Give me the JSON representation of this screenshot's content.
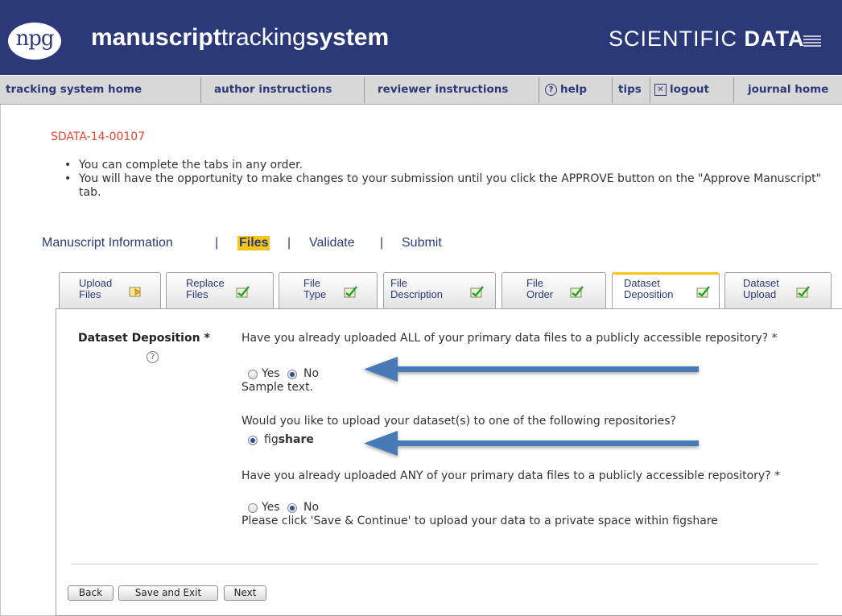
{
  "header": {
    "logo": "npg",
    "title_bold_1": "manuscript",
    "title_light": "tracking",
    "title_bold_2": "system",
    "brand_light": "SCIENTIFIC ",
    "brand_bold": "DATA"
  },
  "nav": {
    "items": [
      {
        "label": "tracking system home"
      },
      {
        "label": "author instructions"
      },
      {
        "label": "reviewer instructions"
      },
      {
        "label": "help",
        "icon": "help-icon"
      },
      {
        "label": "tips"
      },
      {
        "label": "logout",
        "icon": "close-box-icon"
      },
      {
        "label": "journal home"
      }
    ]
  },
  "manuscript_id": "SDATA-14-00107",
  "instructions": [
    "You can complete the tabs in any order.",
    "You will have the opportunity to make changes to your submission until you click the APPROVE button on the \"Approve Manuscript\" tab."
  ],
  "steps": {
    "manuscript_information": "Manuscript Information",
    "files": "Files",
    "validate": "Validate",
    "submit": "Submit",
    "separator": "|"
  },
  "tabs": [
    {
      "label": "Upload\nFiles",
      "icon": "arrow-folder-icon"
    },
    {
      "label": "Replace\nFiles",
      "icon": "checkmark-note-icon"
    },
    {
      "label": "File\nType",
      "icon": "checkmark-note-icon"
    },
    {
      "label": "File\nDescription",
      "icon": "checkmark-note-icon"
    },
    {
      "label": "File\nOrder",
      "icon": "checkmark-note-icon"
    },
    {
      "label": "Dataset\nDeposition",
      "icon": "checkmark-note-icon",
      "active": true
    },
    {
      "label": "Dataset\nUpload",
      "icon": "checkmark-note-icon"
    }
  ],
  "form": {
    "field_label": "Dataset Deposition *",
    "q1": "Have you already uploaded ALL of your primary data files to a publicly accessible repository? *",
    "q1_yes": "Yes",
    "q1_no": "No",
    "q1_selected": "No",
    "sample_text": "Sample text.",
    "q2": "Would you like to upload your dataset(s) to one of the following repositories?",
    "q2_option_light": "fig",
    "q2_option_bold": "share",
    "q2_selected": "figshare",
    "q3": "Have you already uploaded ANY of your primary data files to a publicly accessible repository? *",
    "q3_yes": "Yes",
    "q3_no": "No",
    "q3_selected": "No",
    "note": "Please click 'Save & Continue' to upload your data to a private space within figshare"
  },
  "buttons": {
    "back": "Back",
    "save_exit": "Save and Exit",
    "next": "Next"
  },
  "colors": {
    "header_bg": "#2c3979",
    "accent_yellow": "#f7c418",
    "id_red": "#e8452c",
    "arrow_blue": "#4a7ab8"
  }
}
